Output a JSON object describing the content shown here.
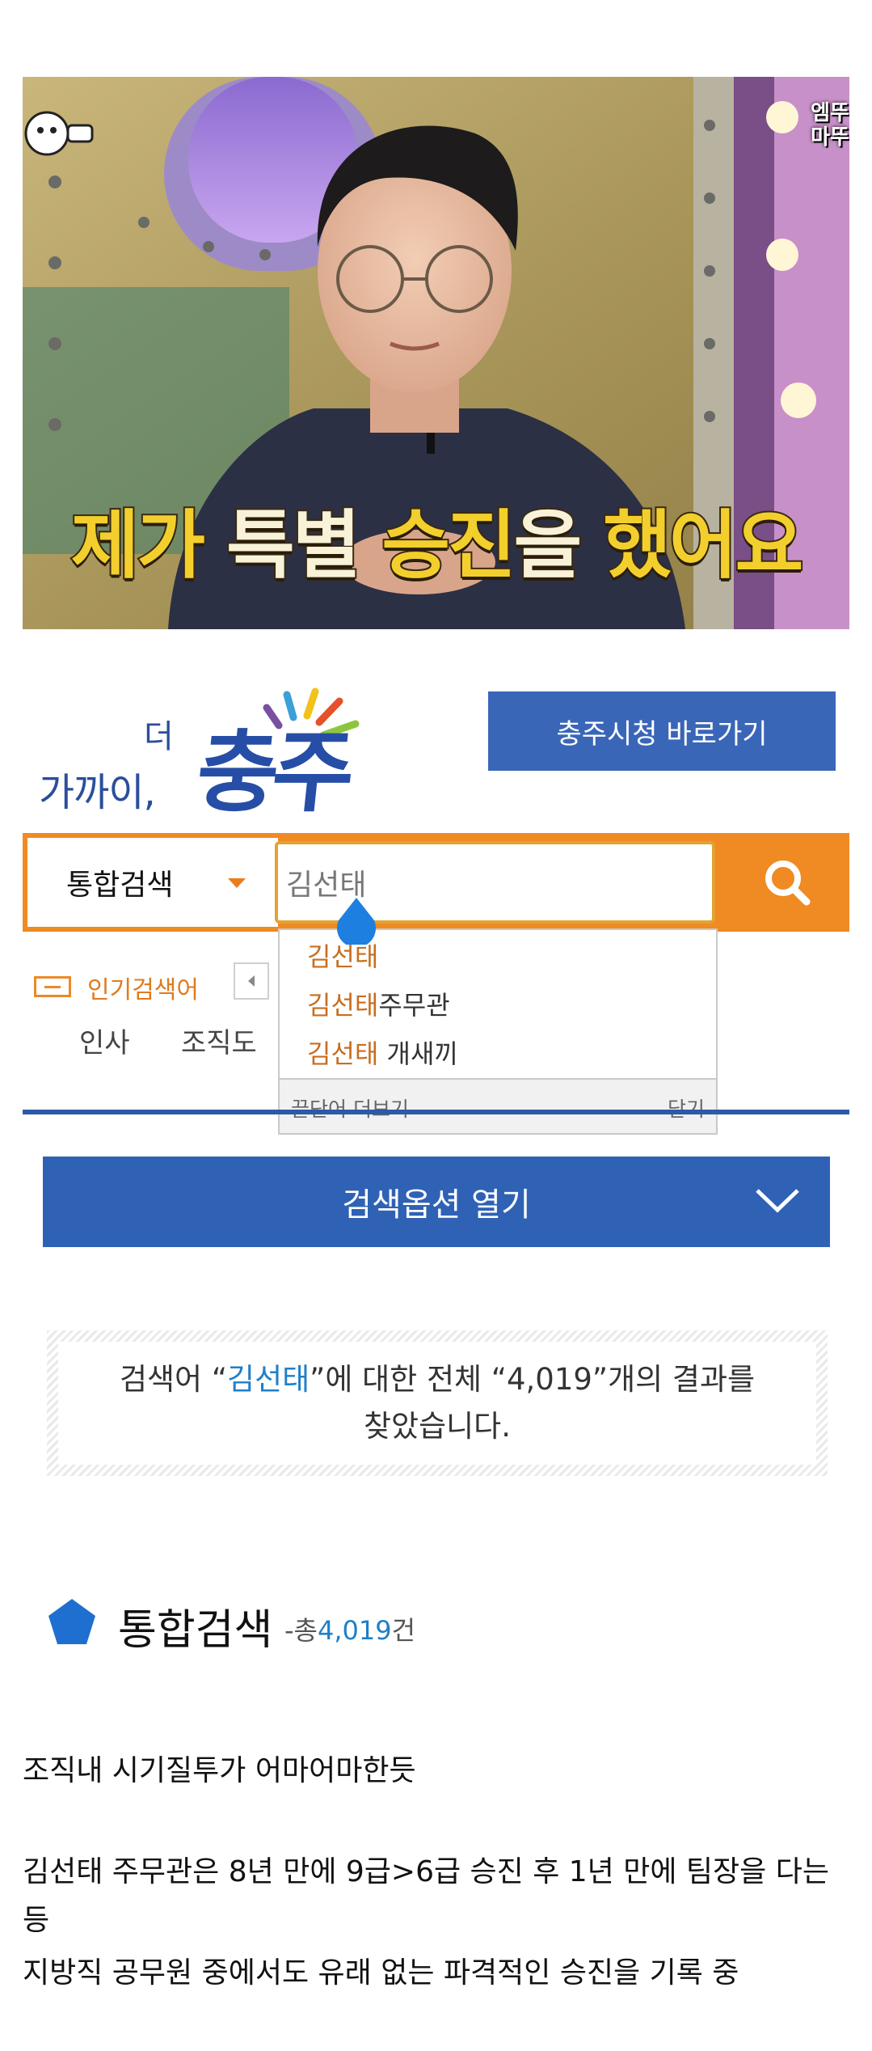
{
  "tv": {
    "caption_parts": [
      "제가",
      "특별",
      "승진",
      "을",
      "했어요"
    ],
    "corner_text": [
      "엠뚜",
      "마뚜"
    ]
  },
  "site": {
    "logo_small": "가까이,",
    "logo_tiny": "더",
    "logo_big": "충주",
    "city_button": "충주시청 바로가기"
  },
  "search": {
    "scope_label": "통합검색",
    "query": "김선태",
    "button_icon": "search-icon"
  },
  "autocomplete": {
    "items": [
      {
        "highlight": "김선태",
        "rest": ""
      },
      {
        "highlight": "김선태",
        "rest": "주무관"
      },
      {
        "highlight": "김선태",
        "rest": " 개새끼"
      }
    ],
    "more_label": "끝단어 더보기",
    "close_label": "닫기"
  },
  "popular": {
    "label": "인기검색어",
    "keywords": [
      "인사",
      "조직도"
    ]
  },
  "options": {
    "label": "검색옵션 열기"
  },
  "result": {
    "prefix": "검색어 “",
    "term": "김선태",
    "middle": "”에 대한 전체 “4,019”개의 결과를",
    "suffix": "찾았습니다."
  },
  "section": {
    "title": "통합검색",
    "count_prefix": "-총",
    "count_value": "4,019",
    "count_suffix": "건"
  },
  "post": {
    "line1": "조직내 시기질투가 어마어마한듯",
    "line2": "김선태 주무관은 8년 만에 9급>6급 승진 후 1년 만에 팀장을 다는",
    "line3": "등",
    "line4": "지방직 공무원 중에서도 유래 없는 파격적인 승진을 기록 중"
  },
  "colors": {
    "orange": "#f08a22",
    "blue": "#2f62b5",
    "highlight": "#c86d1f",
    "result_term": "#1f7fc8"
  }
}
